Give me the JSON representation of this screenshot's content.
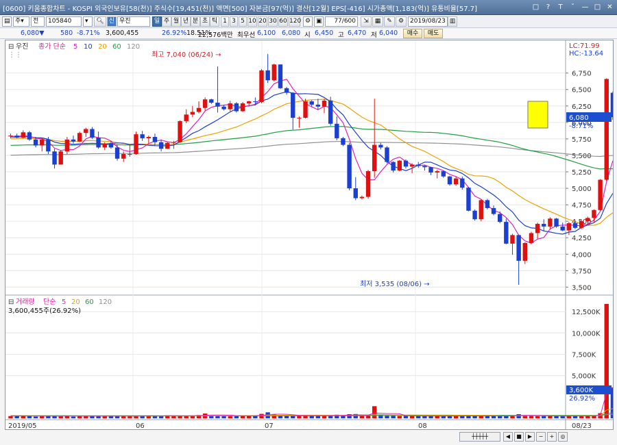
{
  "window": {
    "title": "[0600] 키움종합차트 - KOSPI 외국인보유[58(천)] 주식수[19,451(천)] 액면[500] 자본금[97(억)] 결산[12월] EPS[-416] 시가총액[1,183(억)] 유통비율[57.7]",
    "buttons": [
      "□",
      "?",
      "T",
      "ˇ",
      "—",
      "□",
      "✕"
    ]
  },
  "toolbar": {
    "mode": "주",
    "mode2": "전",
    "code": "105840",
    "stock_badge": "신",
    "stock_name": "우진",
    "periods": [
      "일",
      "주",
      "월",
      "년",
      "분",
      "초",
      "틱"
    ],
    "intervals": [
      "1",
      "3",
      "5",
      "10",
      "20",
      "30",
      "60",
      "120"
    ],
    "count": "77",
    "count_max": "/600",
    "date": "2019/08/23"
  },
  "quote": {
    "price": "6,080",
    "change": "580",
    "change_pct": "-8.71%",
    "volume": "3,600,455",
    "vol_ratio": "26.92%",
    "turnover": "18.51%",
    "amount": "22,576백만",
    "best_ask_label": "최우선",
    "best_ask": "6,100",
    "best_bid": "6,080",
    "open_label": "시",
    "open": "6,450",
    "high_label": "고",
    "high": "6,470",
    "low_label": "저",
    "low": "6,040",
    "buy_label": "매수",
    "sell_label": "매도"
  },
  "price_panel": {
    "stock_label": "우진",
    "legend_prefix": "종가 단순",
    "ma_periods": [
      "5",
      "10",
      "20",
      "60",
      "120"
    ],
    "ma_colors": [
      "#e020c0",
      "#1a3fd0",
      "#f0a000",
      "#20a040",
      "#909090"
    ],
    "lc": "LC:71.99",
    "hc": "HC:-13.64",
    "y_ticks": [
      "6,750",
      "6,500",
      "6,250",
      "6,000",
      "5,750",
      "5,500",
      "5,250",
      "5,000",
      "4,750",
      "4,500",
      "4,250",
      "4,000",
      "3,750",
      "3,500"
    ],
    "current_price": "6,080",
    "current_change": "-8.71%",
    "max_label": "최고 7,040 (06/24) →",
    "min_label": "최저 3,535 (08/06) →"
  },
  "volume_panel": {
    "title": "거래량",
    "legend_prefix": "단순",
    "ma_periods": [
      "5",
      "20",
      "60",
      "120"
    ],
    "ma_colors": [
      "#e020c0",
      "#f0a000",
      "#20a040",
      "#909090"
    ],
    "value_text": "3,600,455주(26.92%)",
    "y_ticks": [
      "12,500K",
      "10,000K",
      "7,500K",
      "5,000K"
    ],
    "current_volume": "3,600K",
    "current_pct": "26.92%"
  },
  "x_axis": {
    "labels": [
      "2019/05",
      "06",
      "07",
      "08",
      "08/23"
    ]
  },
  "chart_data": {
    "type": "candlestick",
    "x": [
      "06/24",
      "08/06",
      "08/23"
    ],
    "close_last": 6080,
    "high_max": 7040,
    "low_min": 3535,
    "last_volume": 3600455,
    "price_range": [
      3400,
      7100
    ],
    "candles": [
      [
        5790,
        5830,
        5760,
        5800
      ],
      [
        5800,
        5830,
        5760,
        5770
      ],
      [
        5770,
        5880,
        5760,
        5850
      ],
      [
        5850,
        5870,
        5720,
        5740
      ],
      [
        5740,
        5780,
        5620,
        5650
      ],
      [
        5650,
        5760,
        5560,
        5740
      ],
      [
        5740,
        5780,
        5520,
        5560
      ],
      [
        5560,
        5600,
        5300,
        5360
      ],
      [
        5360,
        5580,
        5360,
        5560
      ],
      [
        5560,
        5780,
        5520,
        5740
      ],
      [
        5740,
        5800,
        5680,
        5710
      ],
      [
        5710,
        5860,
        5700,
        5840
      ],
      [
        5840,
        5920,
        5780,
        5900
      ],
      [
        5900,
        5930,
        5750,
        5770
      ],
      [
        5770,
        5860,
        5600,
        5620
      ],
      [
        5620,
        5700,
        5580,
        5680
      ],
      [
        5680,
        5720,
        5600,
        5620
      ],
      [
        5620,
        5660,
        5420,
        5450
      ],
      [
        5450,
        5560,
        5400,
        5520
      ],
      [
        5520,
        5650,
        5480,
        5520
      ],
      [
        5520,
        5860,
        5510,
        5820
      ],
      [
        5820,
        5870,
        5720,
        5760
      ],
      [
        5760,
        5800,
        5680,
        5780
      ],
      [
        5780,
        5830,
        5650,
        5700
      ],
      [
        5700,
        5740,
        5560,
        5600
      ],
      [
        5600,
        5700,
        5600,
        5690
      ],
      [
        5690,
        5720,
        5600,
        5700
      ],
      [
        5700,
        6030,
        5690,
        6020
      ],
      [
        6020,
        6200,
        5990,
        6120
      ],
      [
        6120,
        6250,
        6080,
        6160
      ],
      [
        6160,
        6320,
        6140,
        6220
      ],
      [
        6220,
        6380,
        6180,
        6350
      ],
      [
        6350,
        6360,
        6280,
        6300
      ],
      [
        6300,
        6850,
        6150,
        6240
      ],
      [
        6240,
        6270,
        6180,
        6200
      ],
      [
        6200,
        6330,
        6170,
        6290
      ],
      [
        6290,
        6310,
        6150,
        6170
      ],
      [
        6170,
        6310,
        6160,
        6290
      ],
      [
        6290,
        6330,
        6240,
        6320
      ],
      [
        6320,
        6380,
        6260,
        6310
      ],
      [
        6310,
        6810,
        6290,
        6790
      ],
      [
        6790,
        7040,
        6600,
        6640
      ],
      [
        6640,
        6890,
        6620,
        6880
      ],
      [
        6880,
        6880,
        6510,
        6520
      ],
      [
        6520,
        6540,
        6420,
        6450
      ],
      [
        6450,
        6460,
        5890,
        6070
      ],
      [
        6070,
        6090,
        5920,
        6070
      ],
      [
        6070,
        6360,
        6060,
        6320
      ],
      [
        6320,
        6340,
        6240,
        6270
      ],
      [
        6270,
        6360,
        6190,
        6240
      ],
      [
        6240,
        6360,
        6140,
        6330
      ],
      [
        6330,
        6390,
        5950,
        5980
      ],
      [
        5980,
        6090,
        5730,
        5760
      ],
      [
        5760,
        5780,
        5640,
        5660
      ],
      [
        5660,
        5690,
        4970,
        5000
      ],
      [
        5000,
        5170,
        4820,
        4850
      ],
      [
        4850,
        4890,
        4830,
        4870
      ],
      [
        4870,
        5280,
        4840,
        5260
      ],
      [
        5260,
        6360,
        5160,
        5660
      ],
      [
        5660,
        5690,
        5590,
        5620
      ],
      [
        5620,
        5640,
        5380,
        5400
      ],
      [
        5400,
        5410,
        5240,
        5270
      ],
      [
        5270,
        5430,
        5260,
        5420
      ],
      [
        5420,
        5440,
        5300,
        5330
      ],
      [
        5330,
        5380,
        5230,
        5360
      ],
      [
        5360,
        5400,
        5310,
        5340
      ],
      [
        5340,
        5350,
        5270,
        5320
      ],
      [
        5320,
        5330,
        5200,
        5240
      ],
      [
        5240,
        5280,
        5150,
        5260
      ],
      [
        5260,
        5270,
        5160,
        5180
      ],
      [
        5180,
        5190,
        5040,
        5060
      ],
      [
        5060,
        5180,
        5040,
        5150
      ],
      [
        5150,
        5180,
        4980,
        5010
      ],
      [
        5010,
        5020,
        4650,
        4660
      ],
      [
        4660,
        4680,
        4510,
        4530
      ],
      [
        4530,
        4830,
        4500,
        4820
      ],
      [
        4820,
        4840,
        4680,
        4700
      ],
      [
        4700,
        4740,
        4590,
        4610
      ],
      [
        4610,
        4650,
        4470,
        4490
      ],
      [
        4490,
        4540,
        4150,
        4160
      ],
      [
        4160,
        4310,
        3990,
        4290
      ],
      [
        4290,
        4300,
        3535,
        3900
      ],
      [
        3900,
        4180,
        3850,
        4170
      ],
      [
        4170,
        4340,
        4150,
        4320
      ],
      [
        4320,
        4480,
        4230,
        4460
      ],
      [
        4460,
        4530,
        4350,
        4420
      ],
      [
        4420,
        4560,
        4380,
        4540
      ],
      [
        4540,
        4550,
        4400,
        4420
      ],
      [
        4420,
        4480,
        4350,
        4360
      ],
      [
        4360,
        4490,
        4290,
        4470
      ],
      [
        4470,
        4510,
        4380,
        4400
      ],
      [
        4400,
        4520,
        4380,
        4500
      ],
      [
        4500,
        4570,
        4440,
        4550
      ],
      [
        4550,
        4680,
        4490,
        4670
      ],
      [
        4670,
        5140,
        4660,
        5130
      ],
      [
        5130,
        6670,
        5110,
        6660
      ],
      [
        6450,
        6470,
        6040,
        6080
      ]
    ],
    "volumes_k": [
      260,
      300,
      240,
      280,
      200,
      250,
      300,
      260,
      240,
      320,
      200,
      260,
      280,
      240,
      250,
      300,
      260,
      240,
      300,
      280,
      260,
      280,
      320,
      260,
      240,
      350,
      300,
      280,
      260,
      280,
      380,
      560,
      400,
      300,
      280,
      320,
      260,
      280,
      300,
      360,
      520,
      700,
      480,
      360,
      300,
      280,
      320,
      380,
      300,
      280,
      300,
      360,
      420,
      300,
      480,
      500,
      300,
      360,
      1420,
      400,
      280,
      300,
      260,
      280,
      300,
      260,
      240,
      280,
      300,
      260,
      280,
      240,
      300,
      320,
      260,
      280,
      300,
      260,
      280,
      320,
      300,
      480,
      320,
      280,
      260,
      280,
      300,
      240,
      260,
      280,
      300,
      260,
      300,
      320,
      600,
      13400,
      3600
    ]
  }
}
